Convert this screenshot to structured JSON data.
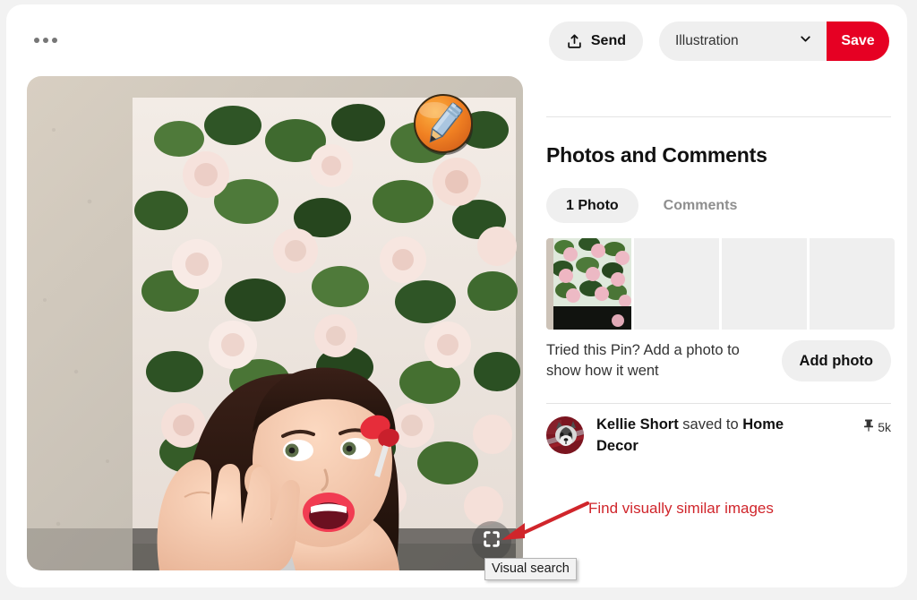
{
  "window": {
    "background_color": "#f2f2f2",
    "card_background": "#ffffff"
  },
  "topbar": {
    "more_options_label": "...",
    "send_label": "Send",
    "send_icon": "share-upload-icon",
    "board_selected": "Illustration",
    "board_chevron_icon": "chevron-down-icon",
    "save_label": "Save",
    "save_color": "#e60023"
  },
  "photo": {
    "alt": "Surprised woman in front of a floral rose painting on a stucco wall",
    "watermark_icon": "orange-pencil-badge",
    "visual_search_icon": "visual-search-crosshair-icon",
    "visual_search_tooltip": "Visual search"
  },
  "annotation": {
    "text": "Find visually similar images",
    "color": "#d0252b",
    "arrow_icon": "red-arrow-icon"
  },
  "panel": {
    "section_title": "Photos and Comments",
    "tabs": [
      {
        "label": "1 Photo",
        "active": true
      },
      {
        "label": "Comments",
        "active": false
      }
    ],
    "thumbnails": [
      {
        "filled": true,
        "alt": "Pink roses floral painting thumbnail"
      },
      {
        "filled": false,
        "alt": ""
      },
      {
        "filled": false,
        "alt": ""
      },
      {
        "filled": false,
        "alt": ""
      }
    ],
    "add_photo_prompt": "Tried this Pin? Add a photo to show how it went",
    "add_photo_label": "Add photo",
    "saver": {
      "avatar_icon": "user-avatar-husky",
      "name": "Kellie Short",
      "middle_text": " saved to ",
      "board": "Home Decor",
      "pin_icon": "pushpin-icon",
      "pin_count": "5k"
    }
  }
}
